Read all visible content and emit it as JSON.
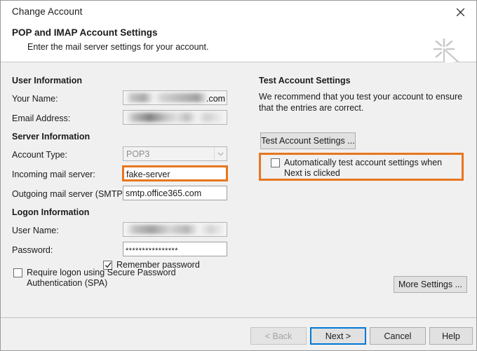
{
  "window": {
    "title": "Change Account",
    "close_icon": "close-icon"
  },
  "header": {
    "title": "POP and IMAP Account Settings",
    "subtitle": "Enter the mail server settings for your account.",
    "watermark_icon": "cursor-sparkle-icon"
  },
  "left_panel": {
    "sections": {
      "user_information": "User Information",
      "server_information": "Server Information",
      "logon_information": "Logon Information"
    },
    "labels": {
      "your_name": "Your Name:",
      "email_address": "Email Address:",
      "account_type": "Account Type:",
      "incoming_mail_server": "Incoming mail server:",
      "outgoing_mail_server": "Outgoing mail server (SMTP):",
      "user_name": "User Name:",
      "password": "Password:"
    },
    "values": {
      "your_name": "",
      "your_name_suffix": ".com",
      "email_address": "",
      "account_type": "POP3",
      "incoming_mail_server": "fake-server",
      "outgoing_mail_server": "smtp.office365.com",
      "user_name": "",
      "password": "****************"
    },
    "checkboxes": {
      "remember_password": {
        "label": "Remember password",
        "checked": true
      },
      "require_spa": {
        "label": "Require logon using Secure Password Authentication (SPA)",
        "checked": false
      }
    }
  },
  "right_panel": {
    "section_title": "Test Account Settings",
    "description": "We recommend that you test your account to ensure that the entries are correct.",
    "test_button": "Test Account Settings ...",
    "auto_test_checkbox": {
      "label": "Automatically test account settings when Next is clicked",
      "checked": false
    },
    "more_settings_button": "More Settings ..."
  },
  "footer": {
    "back_button": "< Back",
    "next_button": "Next >",
    "cancel_button": "Cancel",
    "help_button": "Help"
  },
  "annotations": {
    "highlight_color": "#e8761e",
    "focus_color": "#0078d7"
  }
}
